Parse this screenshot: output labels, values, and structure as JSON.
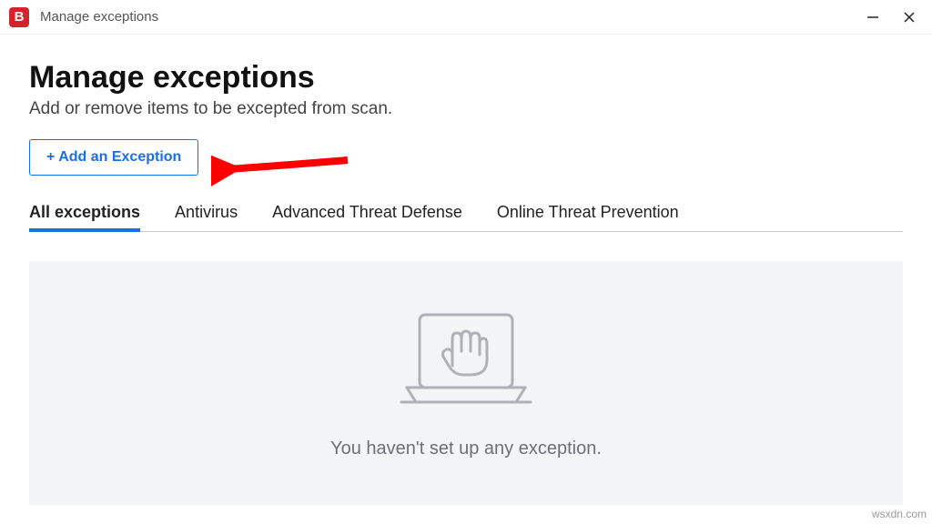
{
  "window": {
    "app_letter": "B",
    "title": "Manage exceptions"
  },
  "header": {
    "title": "Manage exceptions",
    "subtitle": "Add or remove items to be excepted from scan."
  },
  "add_button": {
    "label": "+ Add an Exception"
  },
  "tabs": [
    {
      "label": "All exceptions",
      "active": true
    },
    {
      "label": "Antivirus",
      "active": false
    },
    {
      "label": "Advanced Threat Defense",
      "active": false
    },
    {
      "label": "Online Threat Prevention",
      "active": false
    }
  ],
  "empty_state": {
    "message": "You haven't set up any exception."
  },
  "watermark": "wsxdn.com"
}
